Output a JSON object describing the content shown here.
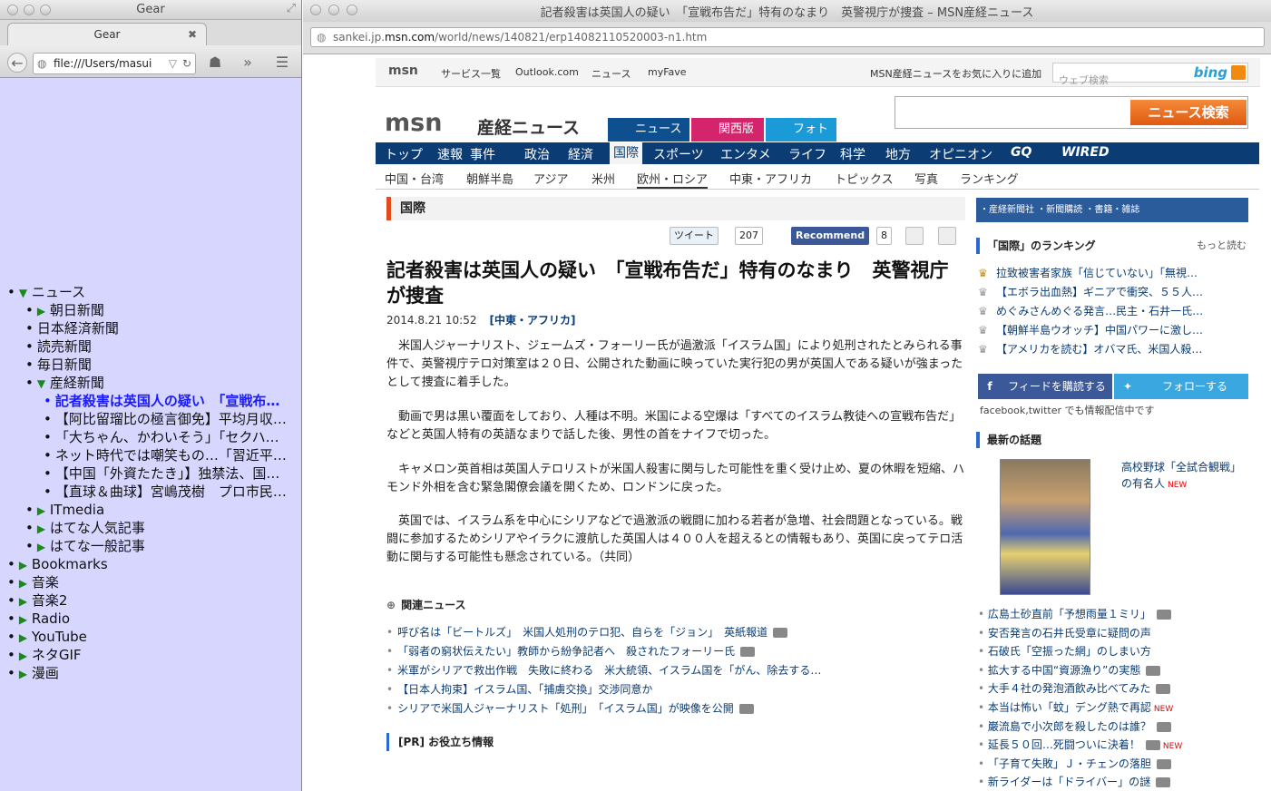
{
  "left_window": {
    "title": "Gear",
    "tab": "Gear",
    "url": "file:///Users/masui",
    "tree": [
      {
        "label": "ニュース",
        "level": 0,
        "expanded": true,
        "has_children": true
      },
      {
        "label": "朝日新聞",
        "level": 1,
        "has_children": true
      },
      {
        "label": "日本経済新聞",
        "level": 1,
        "has_children": false
      },
      {
        "label": "読売新聞",
        "level": 1,
        "has_children": false
      },
      {
        "label": "毎日新聞",
        "level": 1,
        "has_children": false
      },
      {
        "label": "産経新聞",
        "level": 1,
        "expanded": true,
        "has_children": true
      },
      {
        "label": "記者殺害は英国人の疑い　「宣戦布…",
        "level": 2,
        "selected": true
      },
      {
        "label": "【阿比留瑠比の極言御免】平均月収…",
        "level": 2
      },
      {
        "label": "「大ちゃん、かわいそう」「セクハ…",
        "level": 2
      },
      {
        "label": "ネット時代では嘲笑もの…「習近平…",
        "level": 2
      },
      {
        "label": "【中国「外資たたき」】独禁法、国…",
        "level": 2
      },
      {
        "label": "【直球＆曲球】宮嶋茂樹　プロ市民…",
        "level": 2
      },
      {
        "label": "ITmedia",
        "level": 1,
        "has_children": true
      },
      {
        "label": "はてな人気記事",
        "level": 1,
        "has_children": true
      },
      {
        "label": "はてな一般記事",
        "level": 1,
        "has_children": true
      },
      {
        "label": "Bookmarks",
        "level": 0,
        "has_children": true
      },
      {
        "label": "音楽",
        "level": 0,
        "has_children": true
      },
      {
        "label": "音楽2",
        "level": 0,
        "has_children": true
      },
      {
        "label": "Radio",
        "level": 0,
        "has_children": true
      },
      {
        "label": "YouTube",
        "level": 0,
        "has_children": true
      },
      {
        "label": "ネタGIF",
        "level": 0,
        "has_children": true
      },
      {
        "label": "漫画",
        "level": 0,
        "has_children": true
      }
    ]
  },
  "right_window": {
    "title": "記者殺害は英国人の疑い　「宣戦布告だ」特有のなまり　英警視庁が捜査 – MSN産経ニュース",
    "url_prefix": "sankei.jp.",
    "url_domain": "msn.com",
    "url_path": "/world/news/140821/erp14082110520003-n1.htm"
  },
  "msnbar": {
    "logo": "msn",
    "links": [
      "サービス一覧",
      "Outlook.com",
      "ニュース",
      "myFave"
    ],
    "fav": "MSN産経ニュースをお気に入りに追加",
    "search_placeholder": "ウェブ検索",
    "bing": "bing"
  },
  "header": {
    "logo": "msn",
    "site": "産経ニュース",
    "tabs": [
      "ニュース",
      "関西版",
      "フォト"
    ],
    "search_button": "ニュース検索"
  },
  "gnav": [
    "トップ",
    "速報",
    "事件",
    "政治",
    "経済",
    "国際",
    "スポーツ",
    "エンタメ",
    "ライフ",
    "科学",
    "地方",
    "オピニオン",
    "GQ",
    "WIRED"
  ],
  "snav": [
    "中国・台湾",
    "朝鮮半島",
    "アジア",
    "米州",
    "欧州・ロシア",
    "中東・アフリカ",
    "トピックス",
    "写真",
    "ランキング"
  ],
  "article": {
    "section": "国際",
    "tweet": "ツイート",
    "tweet_count": "207",
    "recommend": "Recommend",
    "recommend_count": "8",
    "headline": "記者殺害は英国人の疑い　「宣戦布告だ」特有のなまり　英警視庁が捜査",
    "date": "2014.8.21 10:52",
    "category": "[中東・アフリカ]",
    "paragraphs": [
      "米国人ジャーナリスト、ジェームズ・フォーリー氏が過激派「イスラム国」により処刑されたとみられる事件で、英警視庁テロ対策室は２０日、公開された動画に映っていた実行犯の男が英国人である疑いが強まったとして捜査に着手した。",
      "動画で男は黒い覆面をしており、人種は不明。米国による空爆は「すべてのイスラム教徒への宣戦布告だ」などと英国人特有の英語なまりで話した後、男性の首をナイフで切った。",
      "キャメロン英首相は英国人テロリストが米国人殺害に関与した可能性を重く受け止め、夏の休暇を短縮、ハモンド外相を含む緊急閣僚会議を開くため、ロンドンに戻った。",
      "英国では、イスラム系を中心にシリアなどで過激派の戦闘に加わる若者が急増、社会問題となっている。戦闘に参加するためシリアやイラクに渡航した英国人は４００人を超えるとの情報もあり、英国に戻ってテロ活動に関与する可能性も懸念されている。（共同）"
    ],
    "related_title": "関連ニュース",
    "related": [
      "呼び名は「ビートルズ」　米国人処刑のテロ犯、自らを「ジョン」　英紙報道",
      "「弱者の窮状伝えたい」教師から紛争記者へ　殺されたフォーリー氏",
      "米軍がシリアで救出作戦　失敗に終わる　米大統領、イスラム国を「がん、除去する…",
      "【日本人拘束】イスラム国、「捕虜交換」交渉同意か",
      "シリアで米国人ジャーナリスト「処刑」　「イスラム国」が映像を公開"
    ],
    "pr_title": "[PR] お役立ち情報"
  },
  "sidebar": {
    "banner": "・産経新聞社 ・新聞購読 ・書籍・雑誌",
    "ranking_title": "「国際」のランキング",
    "ranking_more": "もっと読む",
    "ranking": [
      "拉致被害者家族「信じていない」「無視…",
      "【エボラ出血熱】ギニアで衝突、５５人…",
      "めぐみさんめぐる発言…民主・石井一氏…",
      "【朝鮮半島ウオッチ】中国パワーに激し…",
      "【アメリカを読む】オバマ氏、米国人殺…"
    ],
    "facebook": "フィードを購読する",
    "twitter": "フォローする",
    "social_note": "facebook,twitter でも情報配信中です",
    "latest_title": "最新の話題",
    "feature": "高校野球「全試合観戦」の有名人",
    "topics": [
      {
        "text": "広島土砂直前「予想雨量１ミリ」",
        "cam": true,
        "new": false
      },
      {
        "text": "安否発言の石井氏受章に疑問の声",
        "cam": false,
        "new": false
      },
      {
        "text": "石破氏「空振った網」のしまい方",
        "cam": false,
        "new": false
      },
      {
        "text": "拡大する中国“資源漁り”の実態",
        "cam": true,
        "new": false
      },
      {
        "text": "大手４社の発泡酒飲み比べてみた",
        "cam": true,
        "new": false
      },
      {
        "text": "本当は怖い「蚊」デング熱で再認",
        "cam": false,
        "new": true
      },
      {
        "text": "巌流島で小次郎を殺したのは誰？",
        "cam": true,
        "new": false
      },
      {
        "text": "延長５０回…死闘ついに決着！",
        "cam": true,
        "new": true
      },
      {
        "text": "「子育て失敗」Ｊ・チェンの落胆",
        "cam": true,
        "new": false
      },
      {
        "text": "新ライダーは「ドライバー」の謎",
        "cam": true,
        "new": false
      }
    ],
    "new_label": "NEW"
  }
}
